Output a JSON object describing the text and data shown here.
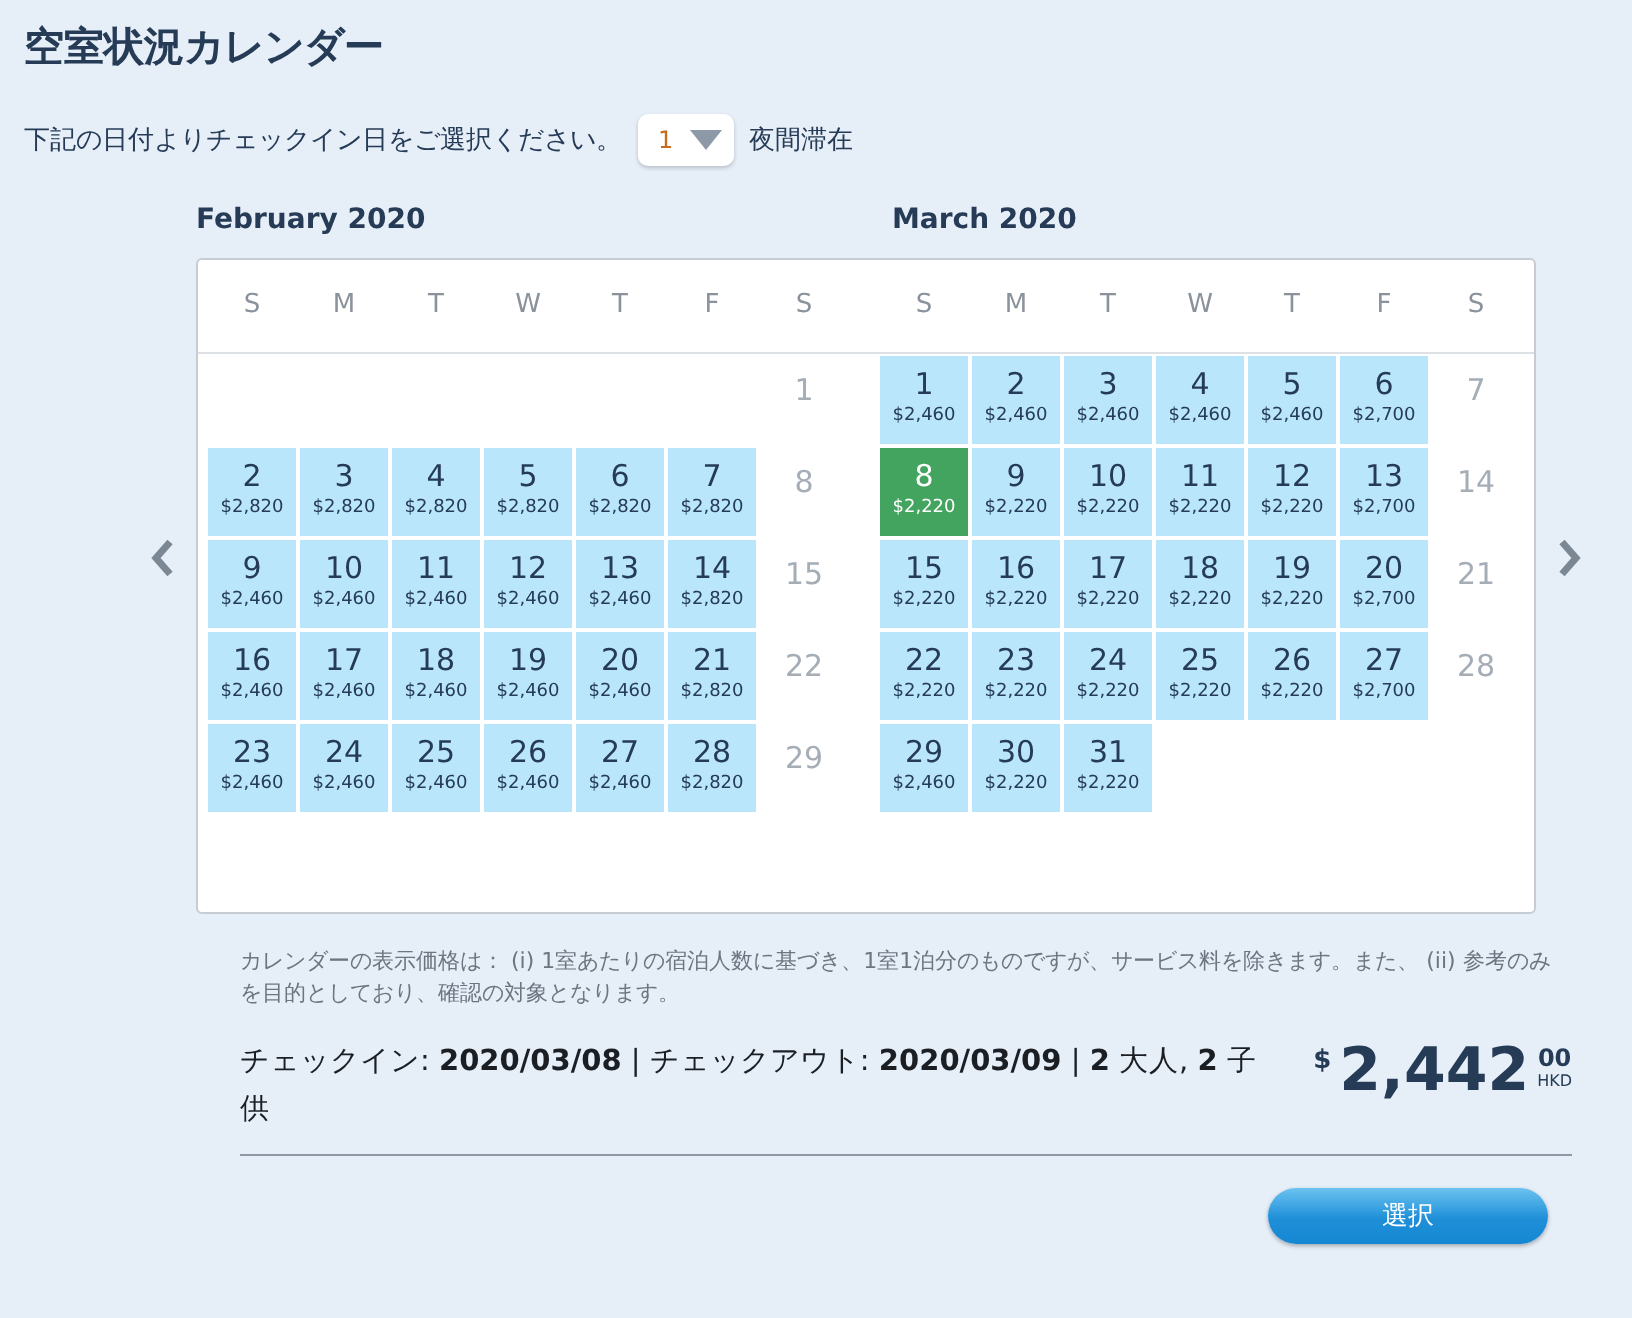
{
  "title": "空室状況カレンダー",
  "instruction": {
    "before": "下記の日付よりチェックイン日をご選択ください。",
    "nights": "1",
    "after": "夜間滞在"
  },
  "months": [
    {
      "title": "February 2020",
      "weekdays": [
        "S",
        "M",
        "T",
        "W",
        "T",
        "F",
        "S"
      ],
      "weeks": [
        [
          {
            "kind": "blank"
          },
          {
            "kind": "blank"
          },
          {
            "kind": "blank"
          },
          {
            "kind": "blank"
          },
          {
            "kind": "blank"
          },
          {
            "kind": "blank"
          },
          {
            "kind": "unavailable",
            "day": "1"
          }
        ],
        [
          {
            "kind": "available",
            "day": "2",
            "price": "$2,820",
            "selected": false
          },
          {
            "kind": "available",
            "day": "3",
            "price": "$2,820",
            "selected": false
          },
          {
            "kind": "available",
            "day": "4",
            "price": "$2,820",
            "selected": false
          },
          {
            "kind": "available",
            "day": "5",
            "price": "$2,820",
            "selected": false
          },
          {
            "kind": "available",
            "day": "6",
            "price": "$2,820",
            "selected": false
          },
          {
            "kind": "available",
            "day": "7",
            "price": "$2,820",
            "selected": false
          },
          {
            "kind": "unavailable",
            "day": "8"
          }
        ],
        [
          {
            "kind": "available",
            "day": "9",
            "price": "$2,460",
            "selected": false
          },
          {
            "kind": "available",
            "day": "10",
            "price": "$2,460",
            "selected": false
          },
          {
            "kind": "available",
            "day": "11",
            "price": "$2,460",
            "selected": false
          },
          {
            "kind": "available",
            "day": "12",
            "price": "$2,460",
            "selected": false
          },
          {
            "kind": "available",
            "day": "13",
            "price": "$2,460",
            "selected": false
          },
          {
            "kind": "available",
            "day": "14",
            "price": "$2,820",
            "selected": false
          },
          {
            "kind": "unavailable",
            "day": "15"
          }
        ],
        [
          {
            "kind": "available",
            "day": "16",
            "price": "$2,460",
            "selected": false
          },
          {
            "kind": "available",
            "day": "17",
            "price": "$2,460",
            "selected": false
          },
          {
            "kind": "available",
            "day": "18",
            "price": "$2,460",
            "selected": false
          },
          {
            "kind": "available",
            "day": "19",
            "price": "$2,460",
            "selected": false
          },
          {
            "kind": "available",
            "day": "20",
            "price": "$2,460",
            "selected": false
          },
          {
            "kind": "available",
            "day": "21",
            "price": "$2,820",
            "selected": false
          },
          {
            "kind": "unavailable",
            "day": "22"
          }
        ],
        [
          {
            "kind": "available",
            "day": "23",
            "price": "$2,460",
            "selected": false
          },
          {
            "kind": "available",
            "day": "24",
            "price": "$2,460",
            "selected": false
          },
          {
            "kind": "available",
            "day": "25",
            "price": "$2,460",
            "selected": false
          },
          {
            "kind": "available",
            "day": "26",
            "price": "$2,460",
            "selected": false
          },
          {
            "kind": "available",
            "day": "27",
            "price": "$2,460",
            "selected": false
          },
          {
            "kind": "available",
            "day": "28",
            "price": "$2,820",
            "selected": false
          },
          {
            "kind": "unavailable",
            "day": "29"
          }
        ]
      ]
    },
    {
      "title": "March 2020",
      "weekdays": [
        "S",
        "M",
        "T",
        "W",
        "T",
        "F",
        "S"
      ],
      "weeks": [
        [
          {
            "kind": "available",
            "day": "1",
            "price": "$2,460",
            "selected": false
          },
          {
            "kind": "available",
            "day": "2",
            "price": "$2,460",
            "selected": false
          },
          {
            "kind": "available",
            "day": "3",
            "price": "$2,460",
            "selected": false
          },
          {
            "kind": "available",
            "day": "4",
            "price": "$2,460",
            "selected": false
          },
          {
            "kind": "available",
            "day": "5",
            "price": "$2,460",
            "selected": false
          },
          {
            "kind": "available",
            "day": "6",
            "price": "$2,700",
            "selected": false
          },
          {
            "kind": "unavailable",
            "day": "7"
          }
        ],
        [
          {
            "kind": "available",
            "day": "8",
            "price": "$2,220",
            "selected": true
          },
          {
            "kind": "available",
            "day": "9",
            "price": "$2,220",
            "selected": false
          },
          {
            "kind": "available",
            "day": "10",
            "price": "$2,220",
            "selected": false
          },
          {
            "kind": "available",
            "day": "11",
            "price": "$2,220",
            "selected": false
          },
          {
            "kind": "available",
            "day": "12",
            "price": "$2,220",
            "selected": false
          },
          {
            "kind": "available",
            "day": "13",
            "price": "$2,700",
            "selected": false
          },
          {
            "kind": "unavailable",
            "day": "14"
          }
        ],
        [
          {
            "kind": "available",
            "day": "15",
            "price": "$2,220",
            "selected": false
          },
          {
            "kind": "available",
            "day": "16",
            "price": "$2,220",
            "selected": false
          },
          {
            "kind": "available",
            "day": "17",
            "price": "$2,220",
            "selected": false
          },
          {
            "kind": "available",
            "day": "18",
            "price": "$2,220",
            "selected": false
          },
          {
            "kind": "available",
            "day": "19",
            "price": "$2,220",
            "selected": false
          },
          {
            "kind": "available",
            "day": "20",
            "price": "$2,700",
            "selected": false
          },
          {
            "kind": "unavailable",
            "day": "21"
          }
        ],
        [
          {
            "kind": "available",
            "day": "22",
            "price": "$2,220",
            "selected": false
          },
          {
            "kind": "available",
            "day": "23",
            "price": "$2,220",
            "selected": false
          },
          {
            "kind": "available",
            "day": "24",
            "price": "$2,220",
            "selected": false
          },
          {
            "kind": "available",
            "day": "25",
            "price": "$2,220",
            "selected": false
          },
          {
            "kind": "available",
            "day": "26",
            "price": "$2,220",
            "selected": false
          },
          {
            "kind": "available",
            "day": "27",
            "price": "$2,700",
            "selected": false
          },
          {
            "kind": "unavailable",
            "day": "28"
          }
        ],
        [
          {
            "kind": "available",
            "day": "29",
            "price": "$2,460",
            "selected": false
          },
          {
            "kind": "available",
            "day": "30",
            "price": "$2,220",
            "selected": false
          },
          {
            "kind": "available",
            "day": "31",
            "price": "$2,220",
            "selected": false
          },
          {
            "kind": "blank"
          },
          {
            "kind": "blank"
          },
          {
            "kind": "blank"
          },
          {
            "kind": "blank"
          }
        ]
      ]
    }
  ],
  "note": "カレンダーの表示価格は： (i) 1室あたりの宿泊人数に基づき、1室1泊分のものですが、サービス料を除きます。また、 (ii) 参考のみを目的としており、確認の対象となります。",
  "summary": "チェックイン: **2020/03/08** | チェックアウト: **2020/03/09** | **2** 大人, **2** 子供",
  "price": {
    "currency": "$",
    "amount": "2,442",
    "cents": "00",
    "code": "HKD"
  },
  "button": "選択"
}
